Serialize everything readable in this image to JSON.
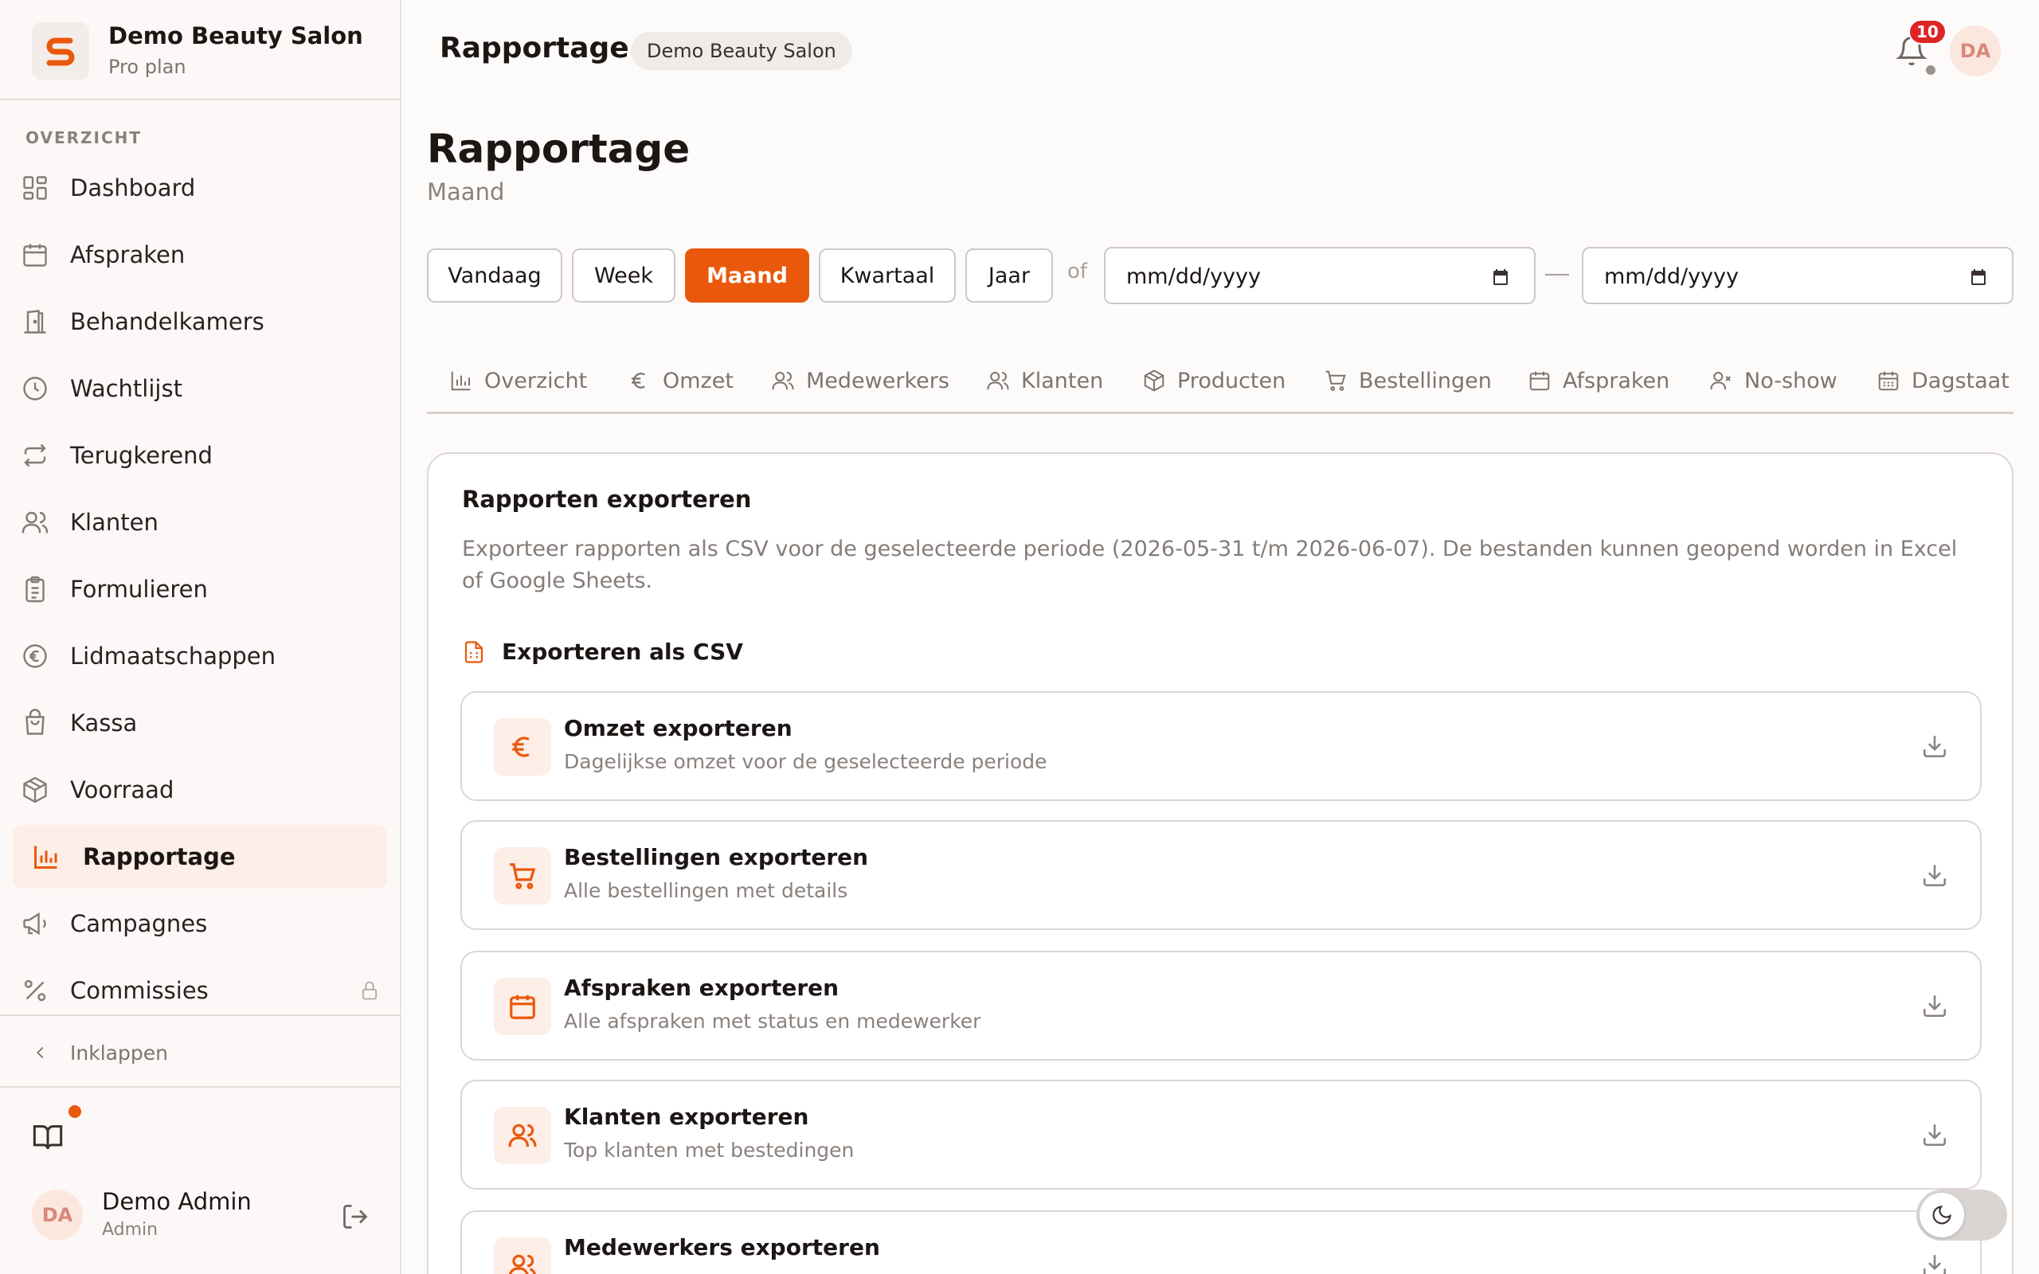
{
  "brand": {
    "name": "Demo Beauty Salon",
    "plan": "Pro plan",
    "logo_letter": "S"
  },
  "sidebar": {
    "section": "OVERZICHT",
    "items": [
      {
        "label": "Dashboard",
        "icon": "grid-icon"
      },
      {
        "label": "Afspraken",
        "icon": "calendar-icon"
      },
      {
        "label": "Behandelkamers",
        "icon": "door-icon"
      },
      {
        "label": "Wachtlijst",
        "icon": "clock-icon"
      },
      {
        "label": "Terugkerend",
        "icon": "repeat-icon"
      },
      {
        "label": "Klanten",
        "icon": "users-icon"
      },
      {
        "label": "Formulieren",
        "icon": "clipboard-icon"
      },
      {
        "label": "Lidmaatschappen",
        "icon": "euro-circle-icon"
      },
      {
        "label": "Kassa",
        "icon": "shopping-bag-icon"
      },
      {
        "label": "Voorraad",
        "icon": "package-icon"
      },
      {
        "label": "Rapportage",
        "icon": "bar-chart-icon",
        "active": true
      },
      {
        "label": "Campagnes",
        "icon": "megaphone-icon"
      },
      {
        "label": "Commissies",
        "icon": "percent-icon",
        "locked": true
      }
    ],
    "collapse_label": "Inklappen"
  },
  "user": {
    "initials": "DA",
    "name": "Demo Admin",
    "role": "Admin"
  },
  "topbar": {
    "title": "Rapportage",
    "chip": "Demo Beauty Salon",
    "notifications": "10",
    "avatar_initials": "DA"
  },
  "page": {
    "title": "Rapportage",
    "subtitle": "Maand",
    "periods": [
      "Vandaag",
      "Week",
      "Maand",
      "Kwartaal",
      "Jaar"
    ],
    "active_period": "Maand",
    "of_label": "of",
    "date_from_placeholder": "mm/dd/yyyy",
    "date_to_placeholder": "mm/dd/yyyy",
    "tabs": [
      {
        "label": "Overzicht",
        "icon": "bar-chart-icon"
      },
      {
        "label": "Omzet",
        "icon": "euro-icon"
      },
      {
        "label": "Medewerkers",
        "icon": "users-icon"
      },
      {
        "label": "Klanten",
        "icon": "users-icon"
      },
      {
        "label": "Producten",
        "icon": "package-icon"
      },
      {
        "label": "Bestellingen",
        "icon": "cart-icon"
      },
      {
        "label": "Afspraken",
        "icon": "calendar-icon"
      },
      {
        "label": "No-show",
        "icon": "user-x-icon"
      },
      {
        "label": "Dagstaat",
        "icon": "calendar-grid-icon"
      }
    ]
  },
  "export_card": {
    "title": "Rapporten exporteren",
    "description": "Exporteer rapporten als CSV voor de geselecteerde periode (2026-05-31 t/m 2026-06-07). De bestanden kunnen geopend worden in Excel of Google Sheets.",
    "csv_heading": "Exporteren als CSV",
    "items": [
      {
        "title": "Omzet exporteren",
        "subtitle": "Dagelijkse omzet voor de geselecteerde periode",
        "icon": "euro-icon"
      },
      {
        "title": "Bestellingen exporteren",
        "subtitle": "Alle bestellingen met details",
        "icon": "cart-icon"
      },
      {
        "title": "Afspraken exporteren",
        "subtitle": "Alle afspraken met status en medewerker",
        "icon": "calendar-icon"
      },
      {
        "title": "Klanten exporteren",
        "subtitle": "Top klanten met bestedingen",
        "icon": "users-icon"
      },
      {
        "title": "Medewerkers exporteren",
        "subtitle": "",
        "icon": "users-icon"
      }
    ]
  },
  "colors": {
    "accent": "#ea580c",
    "accent_soft": "#fdeee7",
    "badge": "#dc2626"
  }
}
